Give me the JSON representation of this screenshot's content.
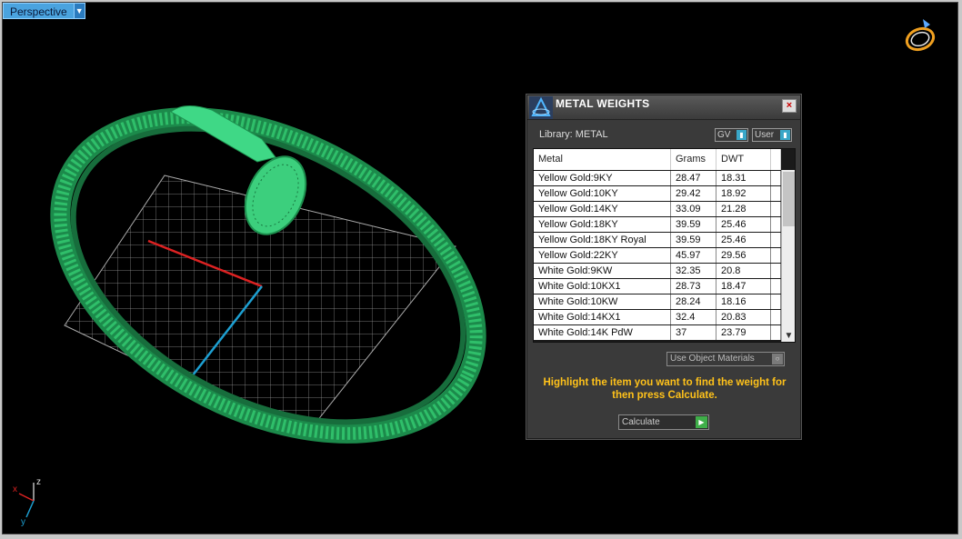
{
  "viewport": {
    "tab_label": "Perspective",
    "tab_dropdown_icon": "chevron-down-icon",
    "axis_labels": {
      "z": "z",
      "x": "x",
      "y": "y"
    }
  },
  "dialog": {
    "title": "METAL WEIGHTS",
    "close_glyph": "×",
    "library_label": "Library: METAL",
    "gv_toggle": "GV",
    "user_toggle": "User",
    "columns": [
      "Metal",
      "Grams",
      "DWT"
    ],
    "rows": [
      {
        "metal": "Yellow Gold:9KY",
        "grams": "28.47",
        "dwt": "18.31"
      },
      {
        "metal": "Yellow Gold:10KY",
        "grams": "29.42",
        "dwt": "18.92"
      },
      {
        "metal": "Yellow Gold:14KY",
        "grams": "33.09",
        "dwt": "21.28"
      },
      {
        "metal": "Yellow Gold:18KY",
        "grams": "39.59",
        "dwt": "25.46"
      },
      {
        "metal": "Yellow Gold:18KY Royal",
        "grams": "39.59",
        "dwt": "25.46"
      },
      {
        "metal": "Yellow Gold:22KY",
        "grams": "45.97",
        "dwt": "29.56"
      },
      {
        "metal": "White Gold:9KW",
        "grams": "32.35",
        "dwt": "20.8"
      },
      {
        "metal": "White Gold:10KX1",
        "grams": "28.73",
        "dwt": "18.47"
      },
      {
        "metal": "White Gold:10KW",
        "grams": "28.24",
        "dwt": "18.16"
      },
      {
        "metal": "White Gold:14KX1",
        "grams": "32.4",
        "dwt": "20.83"
      },
      {
        "metal": "White Gold:14K PdW",
        "grams": "37",
        "dwt": "23.79"
      }
    ],
    "use_object_materials": "Use Object Materials",
    "hint": "Highlight the item you want to find the weight for then press Calculate.",
    "calculate_label": "Calculate",
    "colors": {
      "hint": "#ffc21a",
      "accent": "#3aa7c8",
      "model": "#2fbf6a"
    }
  }
}
